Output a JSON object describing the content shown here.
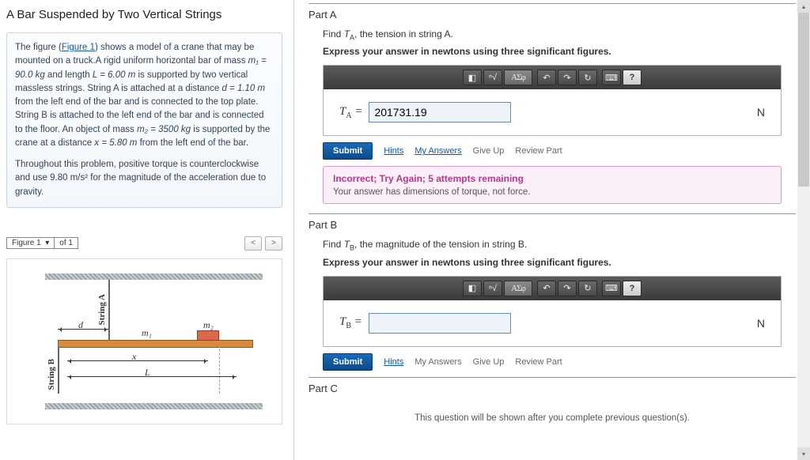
{
  "title": "A Bar Suspended by Two Vertical Strings",
  "description": {
    "intro_pre": "The figure (",
    "fig_link": "Figure 1",
    "intro_post": ") shows a model of a crane that may be mounted on a truck.A rigid uniform horizontal bar of mass ",
    "m1": "m₁ = 90.0 kg",
    "and_len": " and length ",
    "L": "L = 6.00 m",
    "p2": " is supported by two vertical massless strings. String A is attached at a distance ",
    "d": "d = 1.10 m",
    "p3": " from the left end of the bar and is connected to the top plate. String B is attached to the left end of the bar and is connected to the floor. An object of mass ",
    "m2": "m₂ = 3500 kg",
    "p4": " is supported by the crane at a distance ",
    "x": "x = 5.80 m",
    "p5": " from the left end of the bar.",
    "para2": "Throughout this problem, positive torque is counterclockwise and use 9.80 m/s² for the magnitude of the acceleration due to gravity."
  },
  "figure": {
    "selector": "Figure 1",
    "of": "of 1",
    "prev": "<",
    "next": ">",
    "labels": {
      "stringA": "String A",
      "stringB": "String B",
      "m1": "m₁",
      "m2": "m₂",
      "d": "d",
      "x": "x",
      "L": "L"
    }
  },
  "partA": {
    "header": "Part A",
    "prompt_pre": "Find ",
    "var": "T_A",
    "prompt_post": ", the tension in string A.",
    "instruct": "Express your answer in newtons using three significant figures.",
    "label_html": "T_A =",
    "value": "201731.19",
    "unit": "N"
  },
  "toolbar": {
    "greek": "ΑΣφ",
    "undo": "↶",
    "redo": "↷",
    "reset": "↻",
    "kbd": "⌨",
    "help": "?"
  },
  "submit": {
    "submit": "Submit",
    "hints": "Hints",
    "myans": "My Answers",
    "giveup": "Give Up",
    "review": "Review Part"
  },
  "feedback": {
    "head": "Incorrect; Try Again; 5 attempts remaining",
    "body": "Your answer has dimensions of torque, not force."
  },
  "partB": {
    "header": "Part B",
    "prompt_pre": "Find ",
    "var": "T_B",
    "prompt_post": ", the magnitude of the tension in string B.",
    "instruct": "Express your answer in newtons using three significant figures.",
    "label_html": "T_B =",
    "value": "",
    "unit": "N"
  },
  "partC": {
    "header": "Part C",
    "msg": "This question will be shown after you complete previous question(s)."
  }
}
